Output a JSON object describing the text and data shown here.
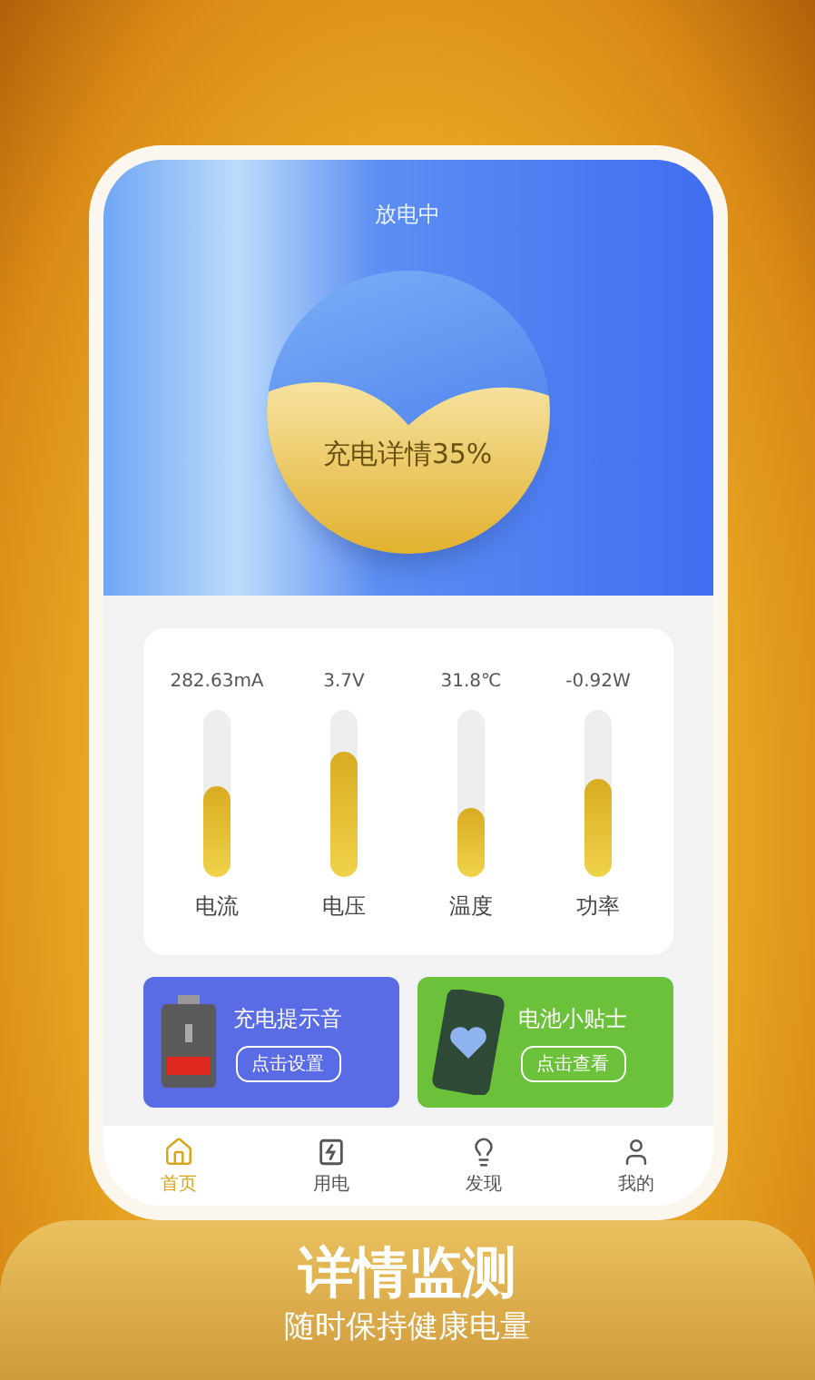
{
  "header": {
    "status": "放电中",
    "ball": {
      "label": "充电详情35%"
    }
  },
  "metrics": [
    {
      "reading": "282.63mA",
      "label": "电流",
      "level": 0.54
    },
    {
      "reading": "3.7V",
      "label": "电压",
      "level": 0.75
    },
    {
      "reading": "31.8℃",
      "label": "温度",
      "level": 0.41
    },
    {
      "reading": "-0.92W",
      "label": "功率",
      "level": 0.59
    }
  ],
  "cards": [
    {
      "kind": "battery",
      "title": "充电提示音",
      "action": "点击设置",
      "color": "#5a6be6"
    },
    {
      "kind": "phone",
      "title": "电池小贴士",
      "action": "点击查看",
      "color": "#6cc13a"
    }
  ],
  "tabs": [
    {
      "kind": "home",
      "label": "首页",
      "selected": true
    },
    {
      "kind": "power",
      "label": "用电",
      "selected": false
    },
    {
      "kind": "bulb",
      "label": "发现",
      "selected": false
    },
    {
      "kind": "user",
      "label": "我的",
      "selected": false
    }
  ],
  "banner": {
    "title": "详情监测",
    "subtitle": "随时保持健康电量"
  }
}
